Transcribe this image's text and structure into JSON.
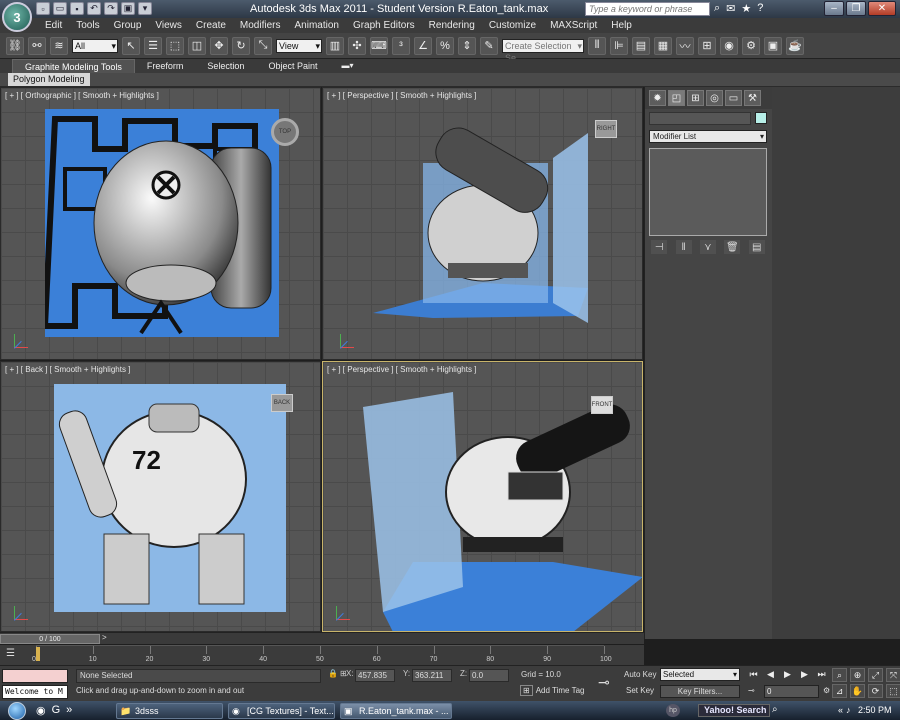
{
  "titlebar": {
    "app_icon": "3ds-max-logo-icon",
    "title": "Autodesk 3ds Max  2011  - Student Version     R.Eaton_tank.max",
    "search_placeholder": "Type a keyword or phrase"
  },
  "menu": [
    "Edit",
    "Tools",
    "Group",
    "Views",
    "Create",
    "Modifiers",
    "Animation",
    "Graph Editors",
    "Rendering",
    "Customize",
    "MAXScript",
    "Help"
  ],
  "toolbar": {
    "filter_value": "All",
    "ref_coord_value": "View",
    "selection_set_placeholder": "Create Selection Se"
  },
  "ribbon": {
    "tabs": [
      "Graphite Modeling Tools",
      "Freeform",
      "Selection",
      "Object Paint"
    ],
    "subtab": "Polygon Modeling"
  },
  "viewports": {
    "top_left": "[ + ] [ Orthographic ] [ Smooth + Highlights ]",
    "top_right": "[ + ] [ Perspective ] [ Smooth + Highlights ]",
    "bottom_left": "[ + ] [ Back ] [ Smooth + Highlights ]",
    "bottom_right": "[ + ] [ Perspective ] [ Smooth + Highlights ]",
    "viewcube_top": "TOP",
    "viewcube_right": "RIGHT",
    "viewcube_back": "BACK",
    "viewcube_front": "FRONT",
    "decal_number": "72"
  },
  "command_panel": {
    "modifier_list": "Modifier List",
    "object_color": "#b7efe8"
  },
  "timeline": {
    "frame_range": "0 / 100",
    "ticks": [
      0,
      10,
      20,
      30,
      40,
      50,
      60,
      70,
      80,
      90,
      100
    ]
  },
  "status": {
    "maxscript_text": "Welcome to M",
    "selection": "None Selected",
    "prompt": "Click and drag up-and-down to zoom in and out",
    "x_label": "X:",
    "x_value": "457.835",
    "y_label": "Y:",
    "y_value": "363.211",
    "z_label": "Z:",
    "z_value": "0.0",
    "grid": "Grid = 10.0",
    "add_time_tag": "Add Time Tag",
    "auto_key": "Auto Key",
    "set_key": "Set Key",
    "selected_dropdown": "Selected",
    "key_filters": "Key Filters...",
    "current_frame": "0"
  },
  "taskbar": {
    "tasks": [
      "3dsss",
      "[CG Textures] - Text...",
      "R.Eaton_tank.max - ..."
    ],
    "search": "Yahoo! Search",
    "clock": "2:50 PM"
  }
}
